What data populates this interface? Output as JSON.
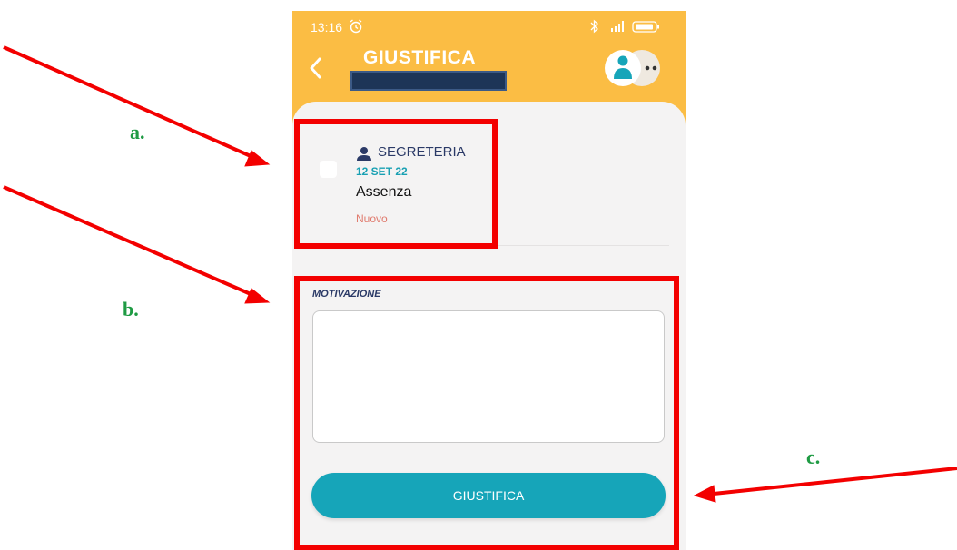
{
  "status_bar": {
    "time": "13:16",
    "icons": [
      "alarm-icon",
      "bluetooth-icon",
      "signal-icon",
      "battery-icon"
    ]
  },
  "header": {
    "title": "GIUSTIFICA",
    "back_icon": "chevron-left-icon",
    "avatar_icon": "user-avatar-icon",
    "more_icon": "more-options-icon"
  },
  "absence": {
    "author": "SEGRETERIA",
    "date": "12 SET 22",
    "type": "Assenza",
    "status": "Nuovo"
  },
  "form": {
    "label": "MOTIVAZIONE",
    "value": "",
    "button_label": "GIUSTIFICA"
  },
  "annotations": {
    "a": "a.",
    "b": "b.",
    "c": "c."
  },
  "colors": {
    "header": "#fbbd44",
    "primary": "#16a5b9",
    "highlight": "#f30000",
    "annotation_text": "#1f9b44",
    "status_new": "#e07a6d"
  }
}
